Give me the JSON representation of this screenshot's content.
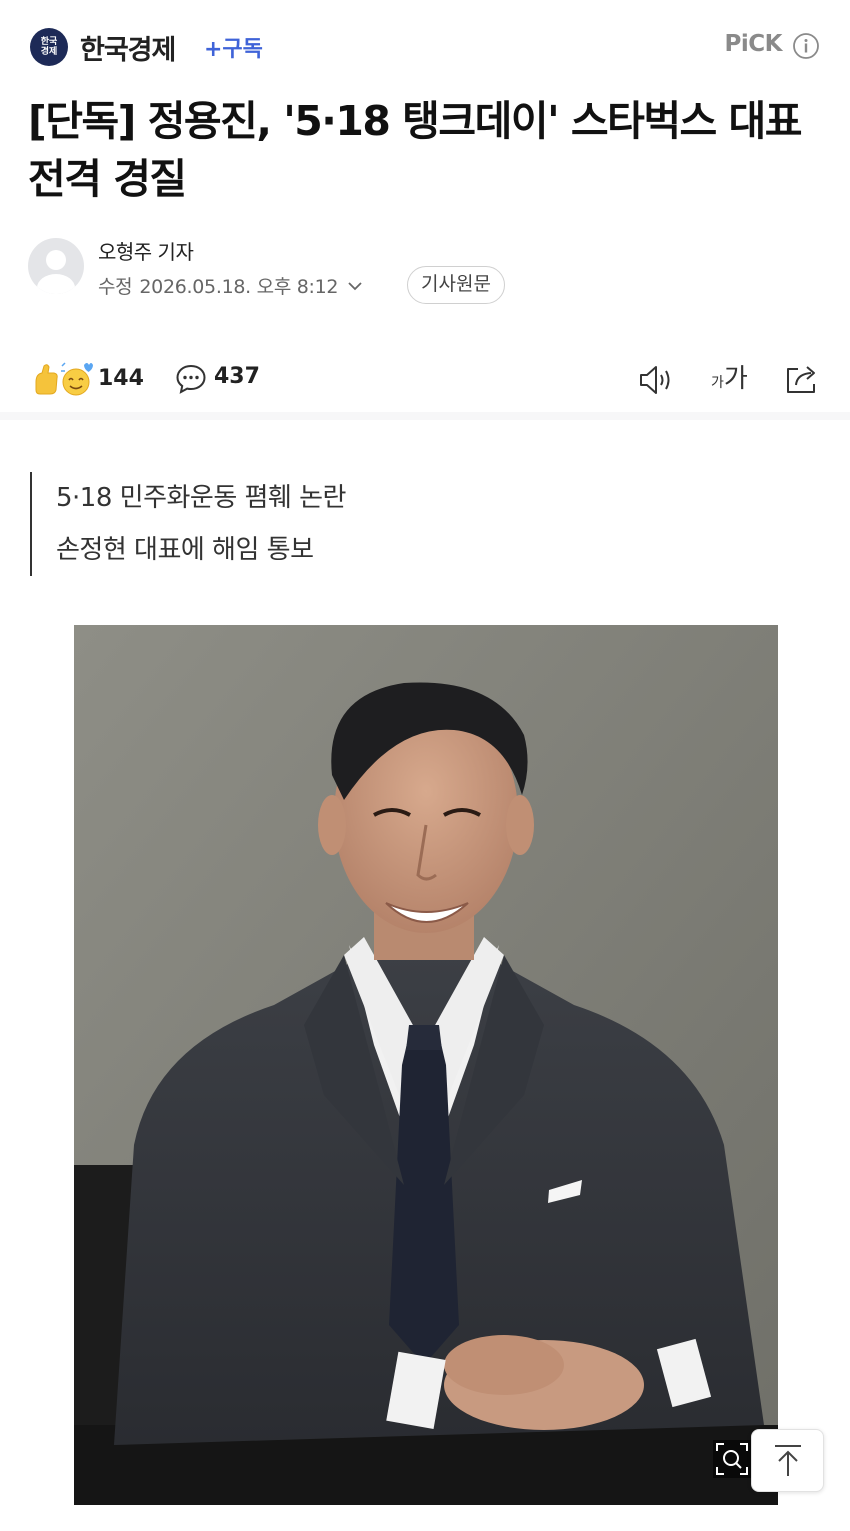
{
  "press": {
    "logo_text": "한국\n경제",
    "name": "한국경제",
    "subscribe_label": "+구독",
    "pick_label": "PiCK"
  },
  "article": {
    "headline": "[단독] 정용진, '5·18 탱크데이' 스타벅스 대표 전격 경질",
    "reporter": "오형주 기자",
    "modified_label": "수정",
    "modified_datetime": "2026.05.18. 오후 8:12",
    "original_link_label": "기사원문",
    "summary": [
      "5·18 민주화운동 폄훼 논란",
      "손정현 대표에 해임 통보"
    ]
  },
  "reactions": {
    "reaction_count": "144",
    "comment_count": "437",
    "font_size_small": "가",
    "font_size_big": "가"
  },
  "icons": {
    "info": "info-icon",
    "chevron": "chevron-down-icon",
    "comment": "comment-bubble-icon",
    "speaker": "speaker-icon",
    "share": "share-icon",
    "zoom": "zoom-icon",
    "scroll_top": "arrow-up-icon"
  },
  "colors": {
    "accent": "#3f63d8",
    "press_logo_bg": "#1d2a57"
  }
}
